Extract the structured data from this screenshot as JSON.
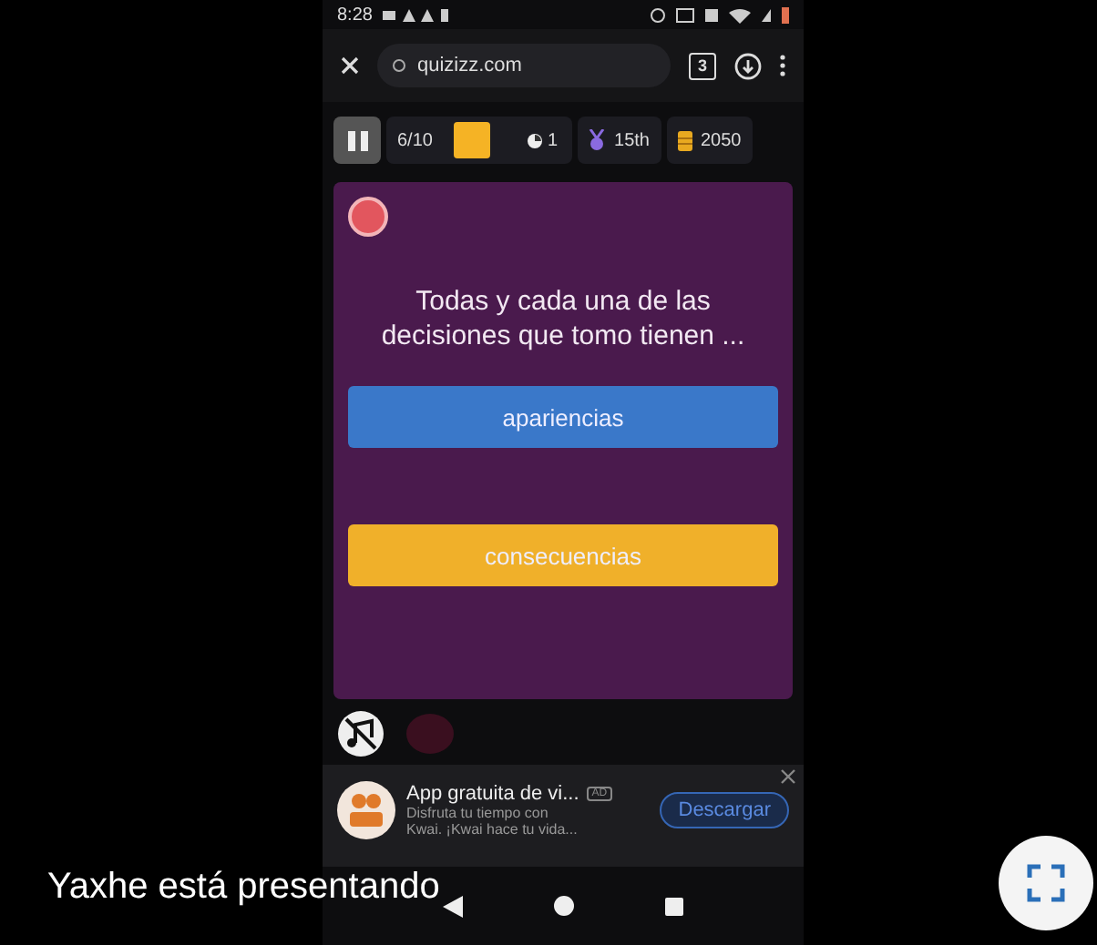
{
  "status_bar": {
    "time": "8:28"
  },
  "browser": {
    "url": "quizizz.com",
    "tab_count": "3"
  },
  "game_bar": {
    "progress": "6/10",
    "streak": "1",
    "rank": "15th",
    "score": "2050"
  },
  "question": {
    "text": "Todas y cada una de las decisiones que tomo tienen ..."
  },
  "options": [
    {
      "label": "apariencias",
      "color": "#3a78c9"
    },
    {
      "label": "consecuencias",
      "color": "#f0b02a"
    }
  ],
  "ad": {
    "title": "App gratuita de vi...",
    "badge": "AD",
    "lines": [
      "Disfruta tu tiempo con",
      "Kwai. ¡Kwai hace tu vida..."
    ],
    "button": "Descargar"
  },
  "presenter": {
    "text": "Yaxhe está presentando"
  }
}
